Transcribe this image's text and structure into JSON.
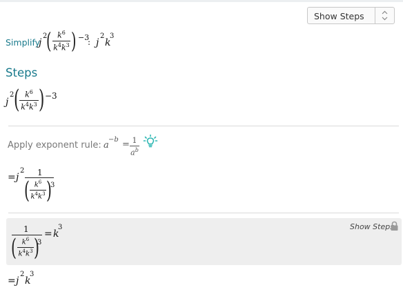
{
  "header": {
    "select_label": "Show Steps"
  },
  "problem": {
    "label": "Simplify",
    "base": "j",
    "base_exp": "2",
    "num": "k",
    "num_exp": "6",
    "den_a": "k",
    "den_a_exp": "4",
    "den_b": "k",
    "den_b_exp": "3",
    "outer_exp": "−3",
    "colon": ":",
    "result_base": "j",
    "result_base_exp": "2",
    "result_k": "k",
    "result_k_exp": "3"
  },
  "steps": {
    "title": "Steps",
    "rule_label": "Apply exponent rule:",
    "rule_lhs_base": "a",
    "rule_lhs_exp": "−b",
    "rule_eq": "=",
    "rule_num": "1",
    "rule_den": "a",
    "rule_den_exp": "b",
    "step2_eq": "=",
    "step2_one": "1",
    "step2_exp": "3",
    "substep_eq": "=",
    "substep_result": "k",
    "substep_result_exp": "3",
    "substep_link": "Show Steps",
    "final_eq": "=",
    "final_j": "j",
    "final_j_exp": "2",
    "final_k": "k",
    "final_k_exp": "3"
  },
  "colors": {
    "accent": "#197a8c",
    "bulb": "#2fb7b3",
    "grey_block": "#eeeeee",
    "divider": "#d9d9d9"
  },
  "icons": {
    "select_arrows": "updown-chevron-icon",
    "hint": "lightbulb-icon",
    "lock": "lock-icon"
  }
}
